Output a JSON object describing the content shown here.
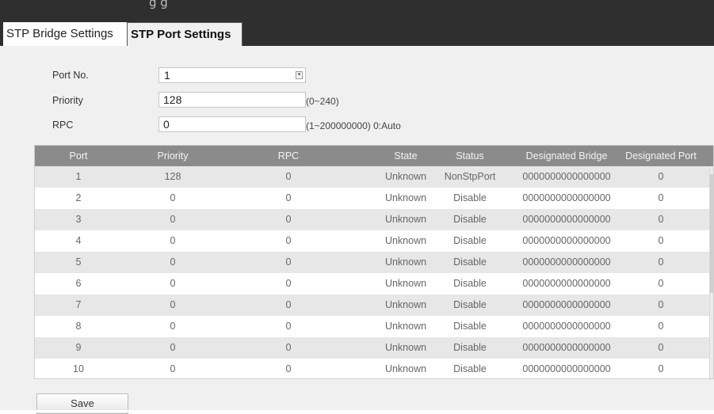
{
  "header": {
    "partial_title": "g                g"
  },
  "tabs": [
    {
      "label": "STP Bridge Settings"
    },
    {
      "label": "STP Port Settings"
    }
  ],
  "form": {
    "port_no": {
      "label": "Port No.",
      "value": "1"
    },
    "priority": {
      "label": "Priority",
      "value": "128",
      "hint": "(0~240)"
    },
    "rpc": {
      "label": "RPC",
      "value": "0",
      "hint": "(1~200000000) 0:Auto"
    }
  },
  "table": {
    "columns": [
      "Port",
      "Priority",
      "RPC",
      "State",
      "Status",
      "Designated Bridge",
      "Designated Port"
    ],
    "rows": [
      [
        "1",
        "128",
        "0",
        "Unknown",
        "NonStpPort",
        "0000000000000000",
        "0"
      ],
      [
        "2",
        "0",
        "0",
        "Unknown",
        "Disable",
        "0000000000000000",
        "0"
      ],
      [
        "3",
        "0",
        "0",
        "Unknown",
        "Disable",
        "0000000000000000",
        "0"
      ],
      [
        "4",
        "0",
        "0",
        "Unknown",
        "Disable",
        "0000000000000000",
        "0"
      ],
      [
        "5",
        "0",
        "0",
        "Unknown",
        "Disable",
        "0000000000000000",
        "0"
      ],
      [
        "6",
        "0",
        "0",
        "Unknown",
        "Disable",
        "0000000000000000",
        "0"
      ],
      [
        "7",
        "0",
        "0",
        "Unknown",
        "Disable",
        "0000000000000000",
        "0"
      ],
      [
        "8",
        "0",
        "0",
        "Unknown",
        "Disable",
        "0000000000000000",
        "0"
      ],
      [
        "9",
        "0",
        "0",
        "Unknown",
        "Disable",
        "0000000000000000",
        "0"
      ],
      [
        "10",
        "0",
        "0",
        "Unknown",
        "Disable",
        "0000000000000000",
        "0"
      ]
    ]
  },
  "actions": {
    "save_label": "Save"
  },
  "colors": {
    "header_bar": "#2f2f2f",
    "table_header": "#8b8b8b",
    "row_alt": "#e7e7e7"
  }
}
